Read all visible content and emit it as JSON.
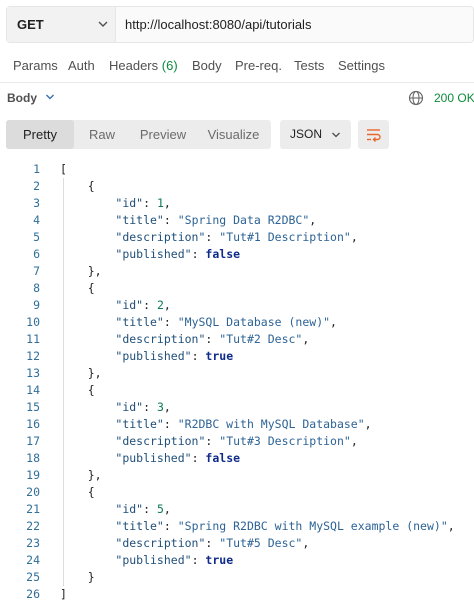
{
  "request": {
    "method": "GET",
    "url": "http://localhost:8080/api/tutorials"
  },
  "request_tabs": [
    {
      "label": "Params"
    },
    {
      "label": "Auth"
    },
    {
      "label": "Headers",
      "count": "(6)"
    },
    {
      "label": "Body"
    },
    {
      "label": "Pre-req."
    },
    {
      "label": "Tests"
    },
    {
      "label": "Settings"
    }
  ],
  "response": {
    "section_label": "Body",
    "status": "200 OK",
    "format_tabs": [
      "Pretty",
      "Raw",
      "Preview",
      "Visualize"
    ],
    "active_format": "Pretty",
    "language": "JSON",
    "icons": {
      "globe": "globe-icon",
      "wrap": "wrap-lines-icon"
    }
  },
  "colors": {
    "status_green": "#0a8c3a",
    "wrap_icon": "#e8672e"
  },
  "code_lines": [
    "[",
    "    {",
    "        \"id\": 1,",
    "        \"title\": \"Spring Data R2DBC\",",
    "        \"description\": \"Tut#1 Description\",",
    "        \"published\": false",
    "    },",
    "    {",
    "        \"id\": 2,",
    "        \"title\": \"MySQL Database (new)\",",
    "        \"description\": \"Tut#2 Desc\",",
    "        \"published\": true",
    "    },",
    "    {",
    "        \"id\": 3,",
    "        \"title\": \"R2DBC with MySQL Database\",",
    "        \"description\": \"Tut#3 Description\",",
    "        \"published\": false",
    "    },",
    "    {",
    "        \"id\": 5,",
    "        \"title\": \"Spring R2DBC with MySQL example (new)\",",
    "        \"description\": \"Tut#5 Desc\",",
    "        \"published\": true",
    "    }",
    "]"
  ]
}
